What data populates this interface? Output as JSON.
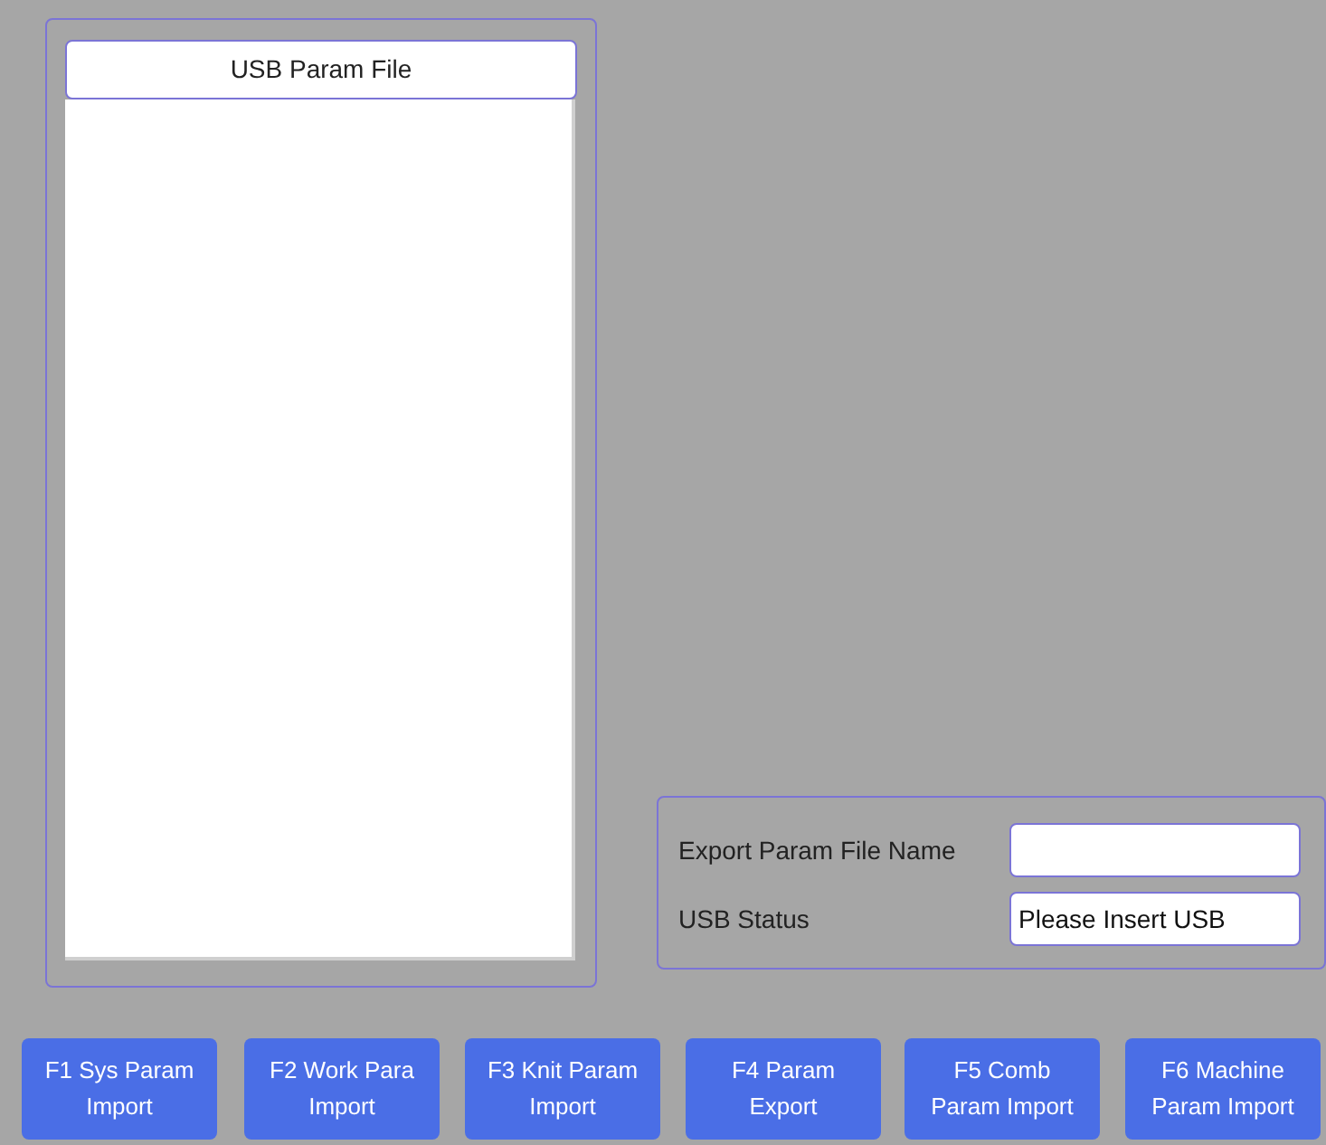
{
  "file_panel": {
    "header": "USB Param File"
  },
  "export_panel": {
    "fields": [
      {
        "label": "Export Param File Name"
      },
      {
        "label": "USB Status",
        "value": "Please Insert USB"
      }
    ]
  },
  "function_buttons": [
    {
      "lines": [
        "F1 Sys Param",
        "Import"
      ]
    },
    {
      "lines": [
        "F2 Work Para",
        "Import"
      ]
    },
    {
      "lines": [
        "F3 Knit Param",
        "Import"
      ]
    },
    {
      "lines": [
        "F4 Param",
        "Export"
      ]
    },
    {
      "lines": [
        "F5 Comb",
        "Param Import"
      ]
    },
    {
      "lines": [
        "F6 Machine",
        "Param Import"
      ]
    }
  ]
}
